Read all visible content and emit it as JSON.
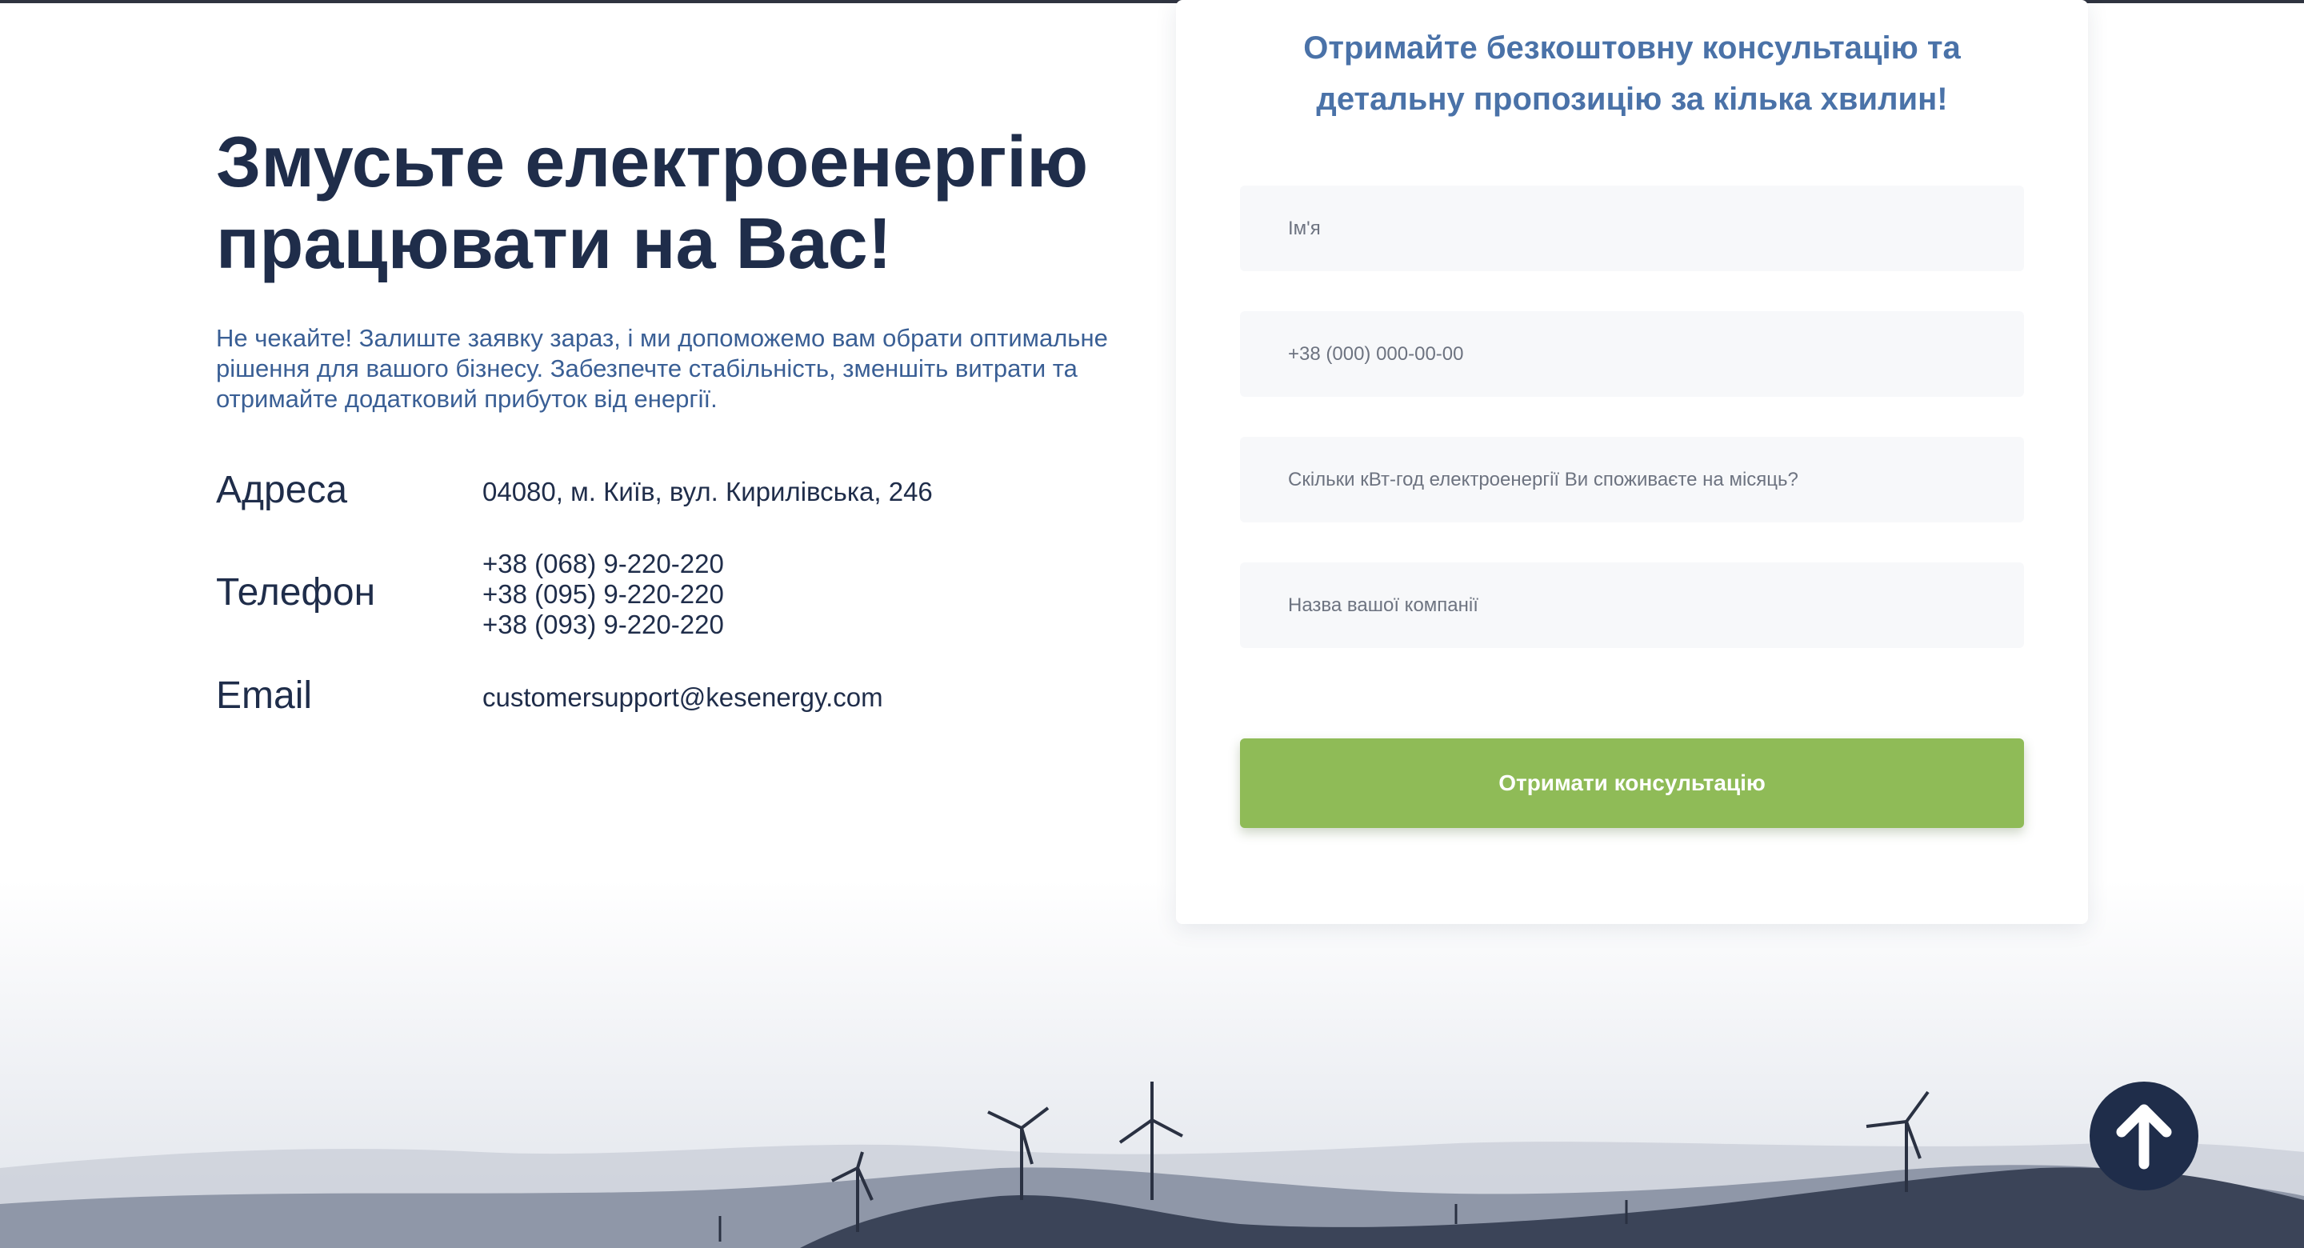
{
  "hero": {
    "title_line1": "Змусьте електроенергію",
    "title_line2": "працювати на Вас!",
    "description": "Не чекайте! Залиште заявку зараз, і ми допоможемо вам обрати оптимальне рішення для вашого бізнесу. Забезпечте стабільність, зменшіть витрати та отримайте додатковий прибуток від енергії."
  },
  "contacts": {
    "address_label": "Адреса",
    "address_value": "04080, м. Київ, вул. Кирилівська, 246",
    "phone_label": "Телефон",
    "phones": [
      "+38 (068) 9-220-220",
      "+38 (095) 9-220-220",
      "+38 (093) 9-220-220"
    ],
    "email_label": "Email",
    "email_value": "customersupport@kesenergy.com"
  },
  "form": {
    "title_line1": "Отримайте безкоштовну консультацію та",
    "title_line2": "детальну пропозицію за кілька хвилин!",
    "name_placeholder": "Ім'я",
    "phone_placeholder": "+38 (000) 000-00-00",
    "consumption_placeholder": "Скільки кВт-год електроенергії Ви споживаєте на місяць?",
    "company_placeholder": "Назва вашої компанії",
    "submit_label": "Отримати консультацію"
  },
  "icons": {
    "scroll_top": "arrow-up-icon",
    "decoration": "wind-turbine-icon"
  },
  "colors": {
    "dark_navy": "#1f2d4a",
    "text_blue": "#3a5f95",
    "form_title_blue": "#4a72a8",
    "button_green": "#8fbb57"
  }
}
